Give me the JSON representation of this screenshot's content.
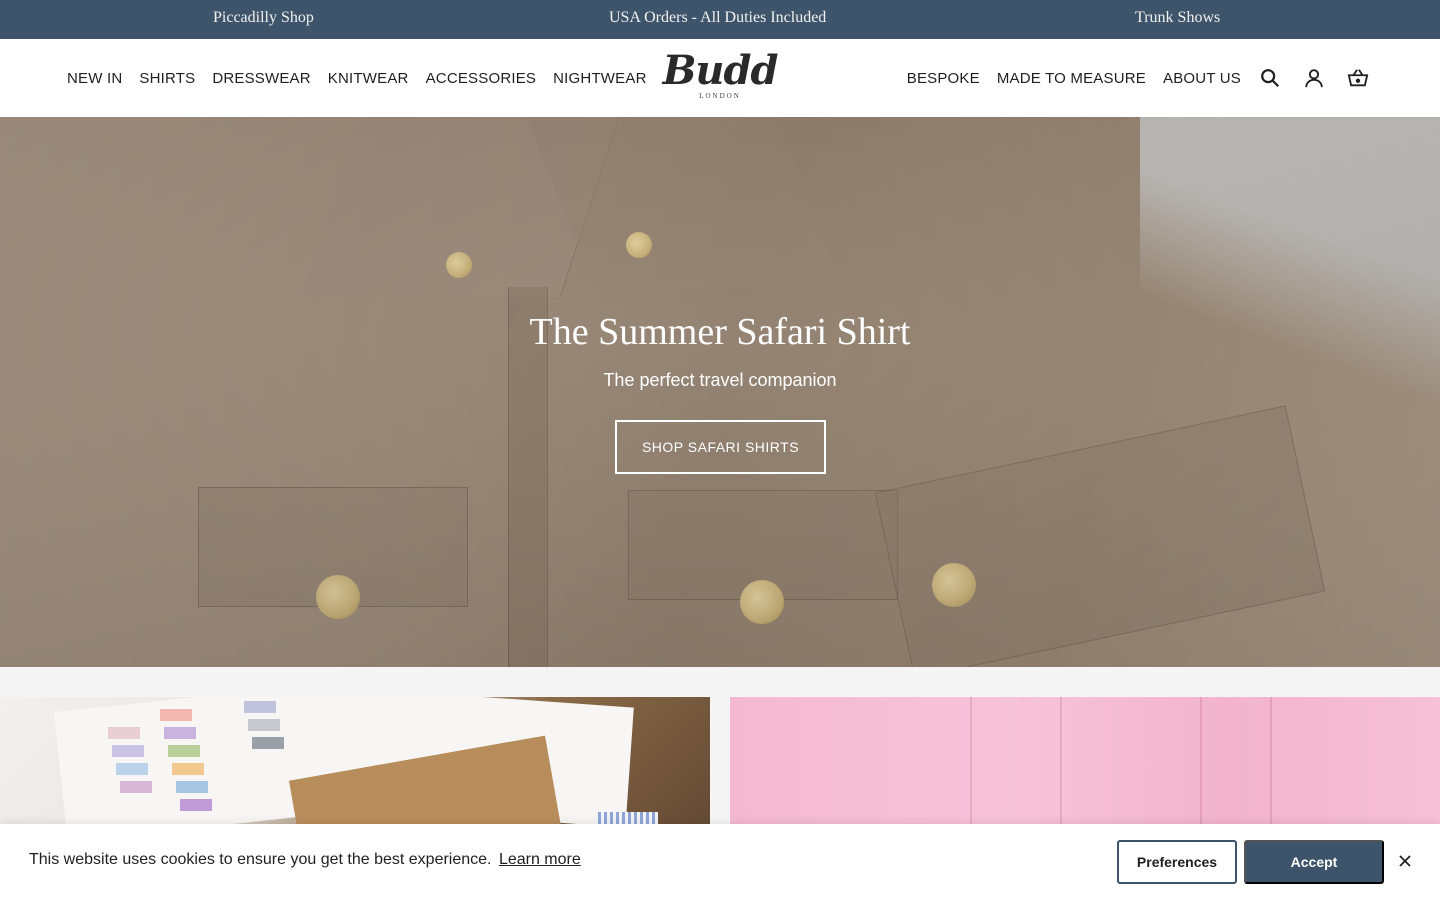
{
  "announcement": {
    "items": [
      "Piccadilly Shop",
      "USA Orders - All Duties Included",
      "Trunk Shows"
    ]
  },
  "header": {
    "nav_left": [
      "NEW IN",
      "SHIRTS",
      "DRESSWEAR",
      "KNITWEAR",
      "ACCESSORIES",
      "NIGHTWEAR"
    ],
    "logo": {
      "word": "Budd",
      "sub": "LONDON"
    },
    "nav_right": [
      "BESPOKE",
      "MADE TO MEASURE",
      "ABOUT US"
    ],
    "icons": [
      "search-icon",
      "account-icon",
      "basket-icon"
    ]
  },
  "hero": {
    "title": "The Summer Safari Shirt",
    "subtitle": "The perfect travel companion",
    "cta": "SHOP SAFARI SHIRTS"
  },
  "cookie": {
    "message": "This website uses cookies to ensure you get the best experience.",
    "link": "Learn more",
    "preferences": "Preferences",
    "accept": "Accept"
  },
  "colors": {
    "brand": "#3e546a",
    "announcement_text": "#f1f1f1",
    "hero_linen": "#a89684"
  }
}
